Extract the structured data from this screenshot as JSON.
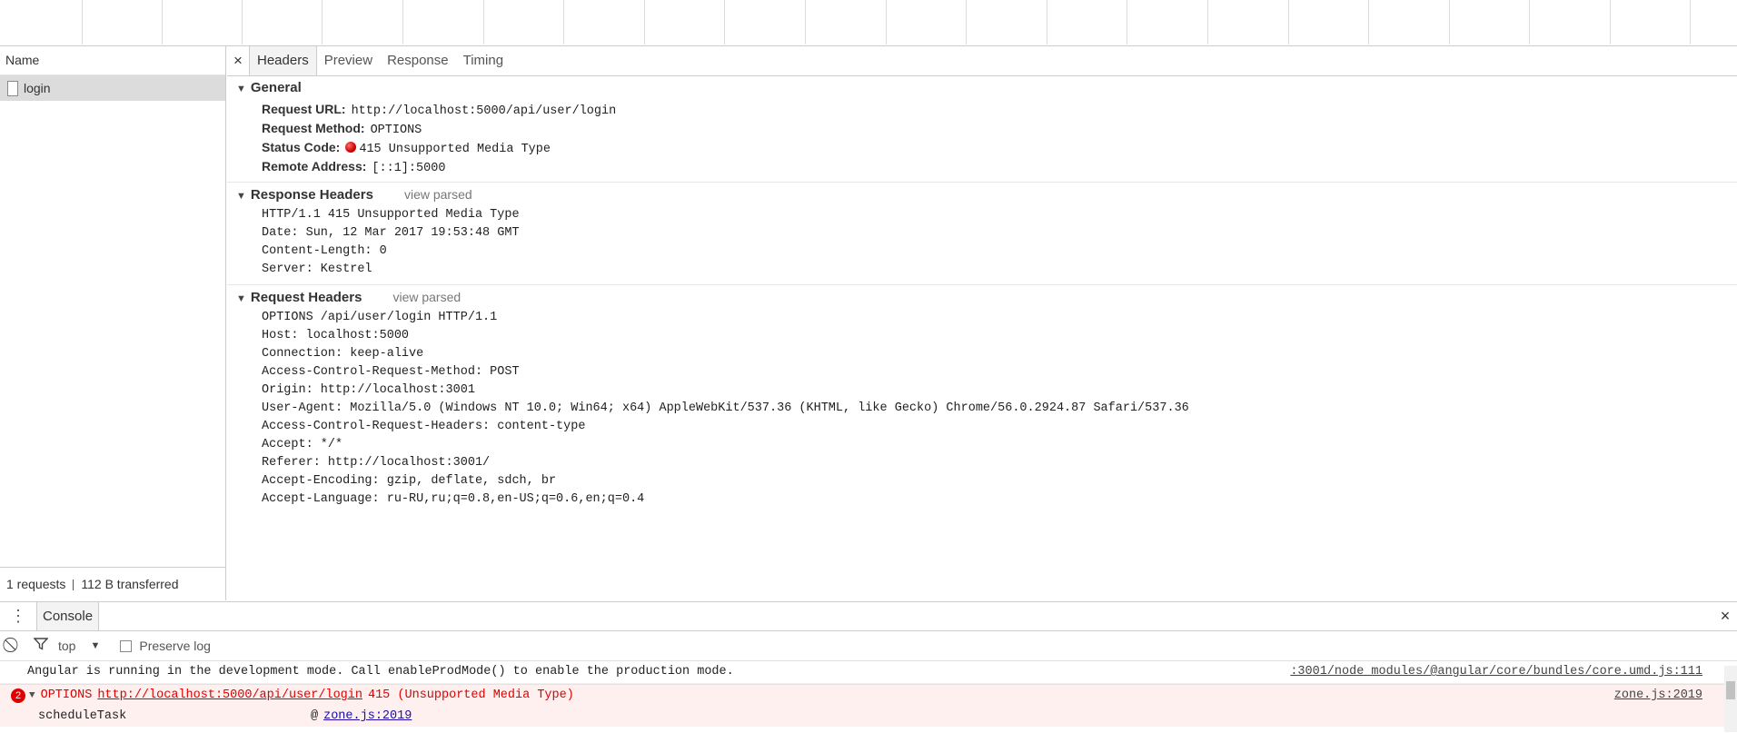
{
  "name_panel": {
    "header": "Name",
    "request_name": "login",
    "summary_requests": "1 requests",
    "summary_transferred": "112 B transferred"
  },
  "details": {
    "close_glyph": "×",
    "tabs": [
      "Headers",
      "Preview",
      "Response",
      "Timing"
    ],
    "general": {
      "title": "General",
      "request_url_label": "Request URL:",
      "request_url": "http://localhost:5000/api/user/login",
      "request_method_label": "Request Method:",
      "request_method": "OPTIONS",
      "status_code_label": "Status Code:",
      "status_code": "415 Unsupported Media Type",
      "remote_address_label": "Remote Address:",
      "remote_address": "[::1]:5000"
    },
    "response_headers": {
      "title": "Response Headers",
      "view_parsed": "view parsed",
      "lines": [
        "HTTP/1.1 415 Unsupported Media Type",
        "Date: Sun, 12 Mar 2017 19:53:48 GMT",
        "Content-Length: 0",
        "Server: Kestrel"
      ]
    },
    "request_headers": {
      "title": "Request Headers",
      "view_parsed": "view parsed",
      "lines": [
        "OPTIONS /api/user/login HTTP/1.1",
        "Host: localhost:5000",
        "Connection: keep-alive",
        "Access-Control-Request-Method: POST",
        "Origin: http://localhost:3001",
        "User-Agent: Mozilla/5.0 (Windows NT 10.0; Win64; x64) AppleWebKit/537.36 (KHTML, like Gecko) Chrome/56.0.2924.87 Safari/537.36",
        "Access-Control-Request-Headers: content-type",
        "Accept: */*",
        "Referer: http://localhost:3001/",
        "Accept-Encoding: gzip, deflate, sdch, br",
        "Accept-Language: ru-RU,ru;q=0.8,en-US;q=0.6,en;q=0.4"
      ]
    }
  },
  "console": {
    "tab_label": "Console",
    "context": "top",
    "preserve_log": "Preserve log",
    "info_message": "Angular is running in the development mode. Call enableProdMode() to enable the production mode.",
    "info_source": ":3001/node_modules/@angular/core/bundles/core.umd.js:111",
    "error_count": "2",
    "error_method": "OPTIONS",
    "error_url": "http://localhost:5000/api/user/login",
    "error_status": "415 (Unsupported Media Type)",
    "error_source": "zone.js:2019",
    "stack_fn": "scheduleTask",
    "stack_at": "@",
    "stack_link": "zone.js:2019"
  },
  "colors": {
    "error_red": "#e00000",
    "error_bg": "#fff0f0",
    "selected_row": "#dcdcdc"
  }
}
